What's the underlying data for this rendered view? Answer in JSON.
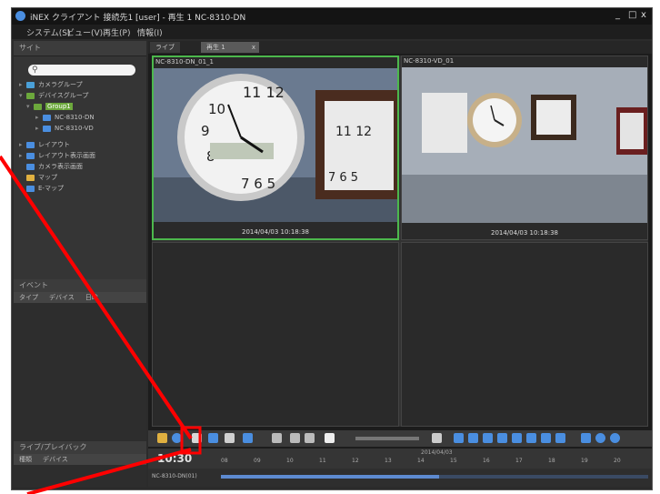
{
  "window": {
    "title": "iNEX クライアント 接続先1 [user] - 再生 1  NC-8310-DN",
    "controls": [
      "_",
      "□",
      "x"
    ]
  },
  "menu": [
    "システム(S)",
    "ビュー(V)",
    "再生(P)",
    "情報(I)"
  ],
  "left_panel": {
    "header": "サイト",
    "search_placeholder": "",
    "tree": [
      {
        "label": "カメラグループ",
        "color": "#4aa0d8"
      },
      {
        "label": "デバイスグループ",
        "color": "#6ca83c"
      },
      {
        "label": "Group1",
        "color": "#6ca83c",
        "selected": true
      },
      {
        "label": "NC-8310-DN",
        "color": "#4a8ee0"
      },
      {
        "label": "NC-8310-VD",
        "color": "#4a8ee0"
      },
      {
        "label": "レイアウト",
        "color": "#4a8ee0"
      },
      {
        "label": "レイアウト表示画面",
        "color": "#4a8ee0"
      },
      {
        "label": "カメラ表示画面",
        "color": "#4a8ee0"
      },
      {
        "label": "マップ",
        "color": "#e0b040"
      },
      {
        "label": "E-マップ",
        "color": "#4a8ee0"
      }
    ]
  },
  "events": {
    "title": "イベント",
    "columns": [
      "タイプ",
      "デバイス",
      "日時"
    ]
  },
  "live_panel": {
    "title": "ライブ/プレイバック",
    "columns": [
      "種類",
      "デバイス"
    ]
  },
  "tabs": [
    {
      "label": "ライブ"
    },
    {
      "label": "再生 1",
      "close": "x",
      "active": true
    }
  ],
  "cameras": [
    {
      "name": "NC-8310-DN_01_1",
      "timestamp": "2014/04/03 10:18:38",
      "active": true
    },
    {
      "name": "NC-8310-VD_01",
      "timestamp": "2014/04/03 10:18:38",
      "active": false
    }
  ],
  "timeline": {
    "clock": "10:30",
    "date": "2014/04/03",
    "row_label": "NC-8310-DN(01)",
    "ticks": [
      "08",
      "09",
      "10",
      "11",
      "12",
      "13",
      "14",
      "15",
      "16",
      "17",
      "18",
      "19",
      "20"
    ]
  },
  "colors": {
    "active_border": "#4cb84c",
    "annotation": "#ff0000",
    "selection": "#6ca83c"
  }
}
